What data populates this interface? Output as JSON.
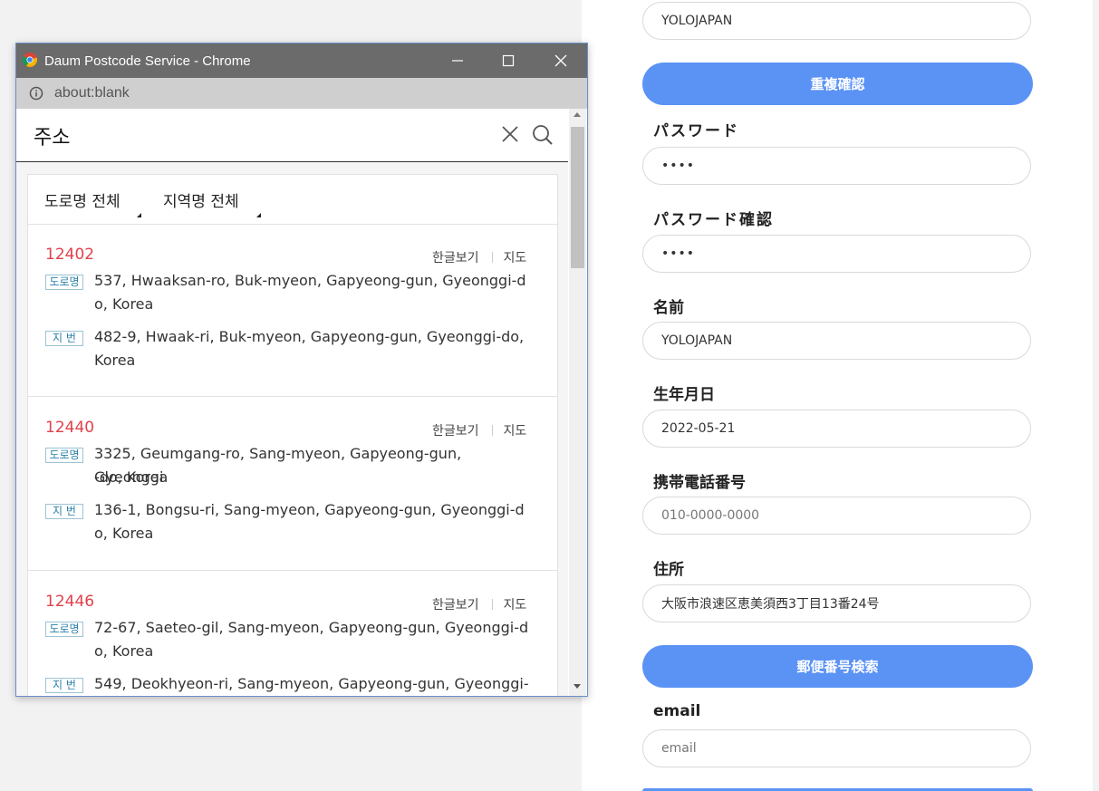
{
  "form": {
    "id_value": "YOLOJAPAN",
    "duplicate_check_label": "重複確認",
    "password_label": "パスワード",
    "password_value": "••••",
    "password_confirm_label": "パスワード確認",
    "password_confirm_value": "••••",
    "name_label": "名前",
    "name_value": "YOLOJAPAN",
    "birthdate_label": "生年月日",
    "birthdate_value": "2022-05-21",
    "phone_label": "携帯電話番号",
    "phone_placeholder": "010-0000-0000",
    "address_label": "住所",
    "address_value": "大阪市浪速区恵美須西3丁目13番24号",
    "postcode_search_label": "郵便番号検索",
    "email_label": "email",
    "email_placeholder": "email"
  },
  "popup": {
    "title": "Daum Postcode Service - Chrome",
    "address_bar": "about:blank",
    "search_query": "주소",
    "filters": [
      "도로명 전체",
      "지역명 전체"
    ],
    "link_korean": "한글보기",
    "link_map": "지도",
    "tag_road": "도로명",
    "tag_lot": "지 번",
    "results": [
      {
        "zipcode": "12402",
        "road_line1": "537, Hwaaksan-ro, Buk-myeon, Gapyeong-gun, Gyeonggi-d",
        "road_line2": "o, Korea",
        "lot_line1": "482-9, Hwaak-ri, Buk-myeon, Gapyeong-gun, Gyeonggi-do,",
        "lot_line2": "Korea"
      },
      {
        "zipcode": "12440",
        "road_line1": "3325, Geumgang-ro, Sang-myeon, Gapyeong-gun, Gyeonggi",
        "road_line2": "-do, Korea",
        "lot_line1": "136-1, Bongsu-ri, Sang-myeon, Gapyeong-gun, Gyeonggi-d",
        "lot_line2": "o, Korea"
      },
      {
        "zipcode": "12446",
        "road_line1": "72-67, Saeteo-gil, Sang-myeon, Gapyeong-gun, Gyeonggi-d",
        "road_line2": "o, Korea",
        "lot_line1": "549, Deokhyeon-ri, Sang-myeon, Gapyeong-gun, Gyeonggi-",
        "lot_line2": ""
      }
    ]
  },
  "colors": {
    "accent_button": "#5b93f5",
    "zipcode_red": "#e0414b",
    "titlebar": "#6b6b6b"
  }
}
